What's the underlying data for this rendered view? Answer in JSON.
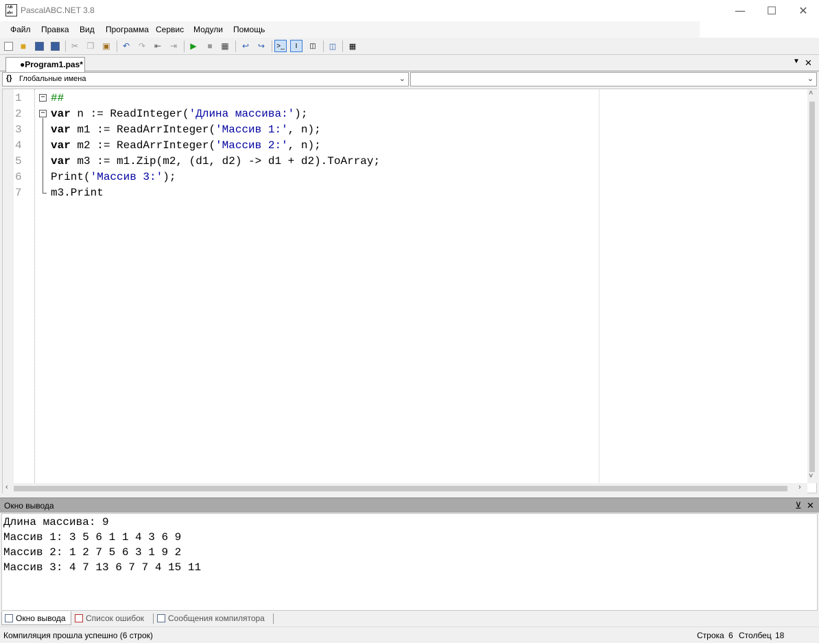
{
  "window": {
    "title": "PascalABC.NET 3.8",
    "icon_text": "AB\nabc"
  },
  "menu": [
    "Файл",
    "Правка",
    "Вид",
    "Программа",
    "Сервис",
    "Модули",
    "Помощь"
  ],
  "tabs": [
    {
      "label": "●Program1.pas*"
    }
  ],
  "combos": {
    "left": "Глобальные имена",
    "left_icon": "{}",
    "right": ""
  },
  "editor": {
    "line_numbers": [
      "1",
      "2",
      "3",
      "4",
      "5",
      "6",
      "7"
    ],
    "lines": [
      {
        "parts": [
          {
            "t": "##",
            "c": "cmt"
          }
        ]
      },
      {
        "parts": [
          {
            "t": "var",
            "c": "kw"
          },
          {
            "t": " n := ReadInteger(",
            "c": ""
          },
          {
            "t": "'Длина массива:'",
            "c": "str"
          },
          {
            "t": ");",
            "c": ""
          }
        ]
      },
      {
        "parts": [
          {
            "t": "var",
            "c": "kw"
          },
          {
            "t": " m1 := ReadArrInteger(",
            "c": ""
          },
          {
            "t": "'Массив 1:'",
            "c": "str"
          },
          {
            "t": ", n);",
            "c": ""
          }
        ]
      },
      {
        "parts": [
          {
            "t": "var",
            "c": "kw"
          },
          {
            "t": " m2 := ReadArrInteger(",
            "c": ""
          },
          {
            "t": "'Массив 2:'",
            "c": "str"
          },
          {
            "t": ", n);",
            "c": ""
          }
        ]
      },
      {
        "parts": [
          {
            "t": "var",
            "c": "kw"
          },
          {
            "t": " m3 := m1.Zip(m2, (d1, d2) -> d1 + d2).ToArray;",
            "c": ""
          }
        ]
      },
      {
        "parts": [
          {
            "t": "Print(",
            "c": ""
          },
          {
            "t": "'Массив 3:'",
            "c": "str"
          },
          {
            "t": ");",
            "c": ""
          }
        ]
      },
      {
        "parts": [
          {
            "t": "m3.Print",
            "c": ""
          }
        ]
      }
    ]
  },
  "output": {
    "title": "Окно вывода",
    "lines": [
      "Длина массива: 9",
      "Массив 1: 3 5 6 1 1 4 3 6 9",
      "Массив 2: 1 2 7 5 6 3 1 9 2",
      "Массив 3: 4 7 13 6 7 7 4 15 11"
    ]
  },
  "bottom_tabs": [
    "Окно вывода",
    "Список ошибок",
    "Сообщения компилятора"
  ],
  "status": {
    "message": "Компиляция прошла успешно (6 строк)",
    "row_label": "Строка",
    "row": "6",
    "col_label": "Столбец",
    "col": "18"
  }
}
